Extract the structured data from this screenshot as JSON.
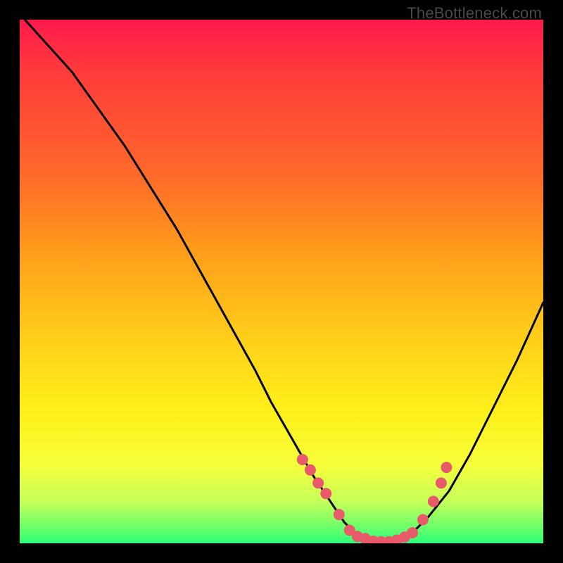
{
  "watermark": "TheBottleneck.com",
  "chart_data": {
    "type": "line",
    "title": "",
    "xlabel": "",
    "ylabel": "",
    "xlim": [
      0,
      100
    ],
    "ylim": [
      0,
      100
    ],
    "series": [
      {
        "name": "curve",
        "x": [
          1,
          10,
          20,
          30,
          40,
          45,
          48,
          52,
          56,
          58,
          60,
          62,
          64,
          66,
          68,
          70,
          72,
          75,
          78,
          82,
          86,
          90,
          95,
          100
        ],
        "values": [
          100,
          90,
          76,
          60,
          42,
          33,
          27,
          20,
          13,
          10,
          7,
          4,
          2,
          1,
          0.5,
          0.5,
          1,
          2,
          5,
          10,
          17,
          25,
          35,
          46
        ]
      }
    ],
    "markers": {
      "name": "dots",
      "x": [
        54,
        55.5,
        57,
        58.5,
        61,
        63,
        64.5,
        66,
        67.5,
        69,
        70.5,
        72,
        73.5,
        75,
        77,
        79,
        80.5,
        81.5
      ],
      "values": [
        16,
        14,
        11.5,
        9.5,
        5.5,
        2.5,
        1.3,
        0.9,
        0.4,
        0.3,
        0.3,
        0.6,
        1.2,
        2.0,
        4.5,
        8.0,
        11.5,
        14.5
      ],
      "color": "#e85a6a",
      "radius": 8
    }
  }
}
